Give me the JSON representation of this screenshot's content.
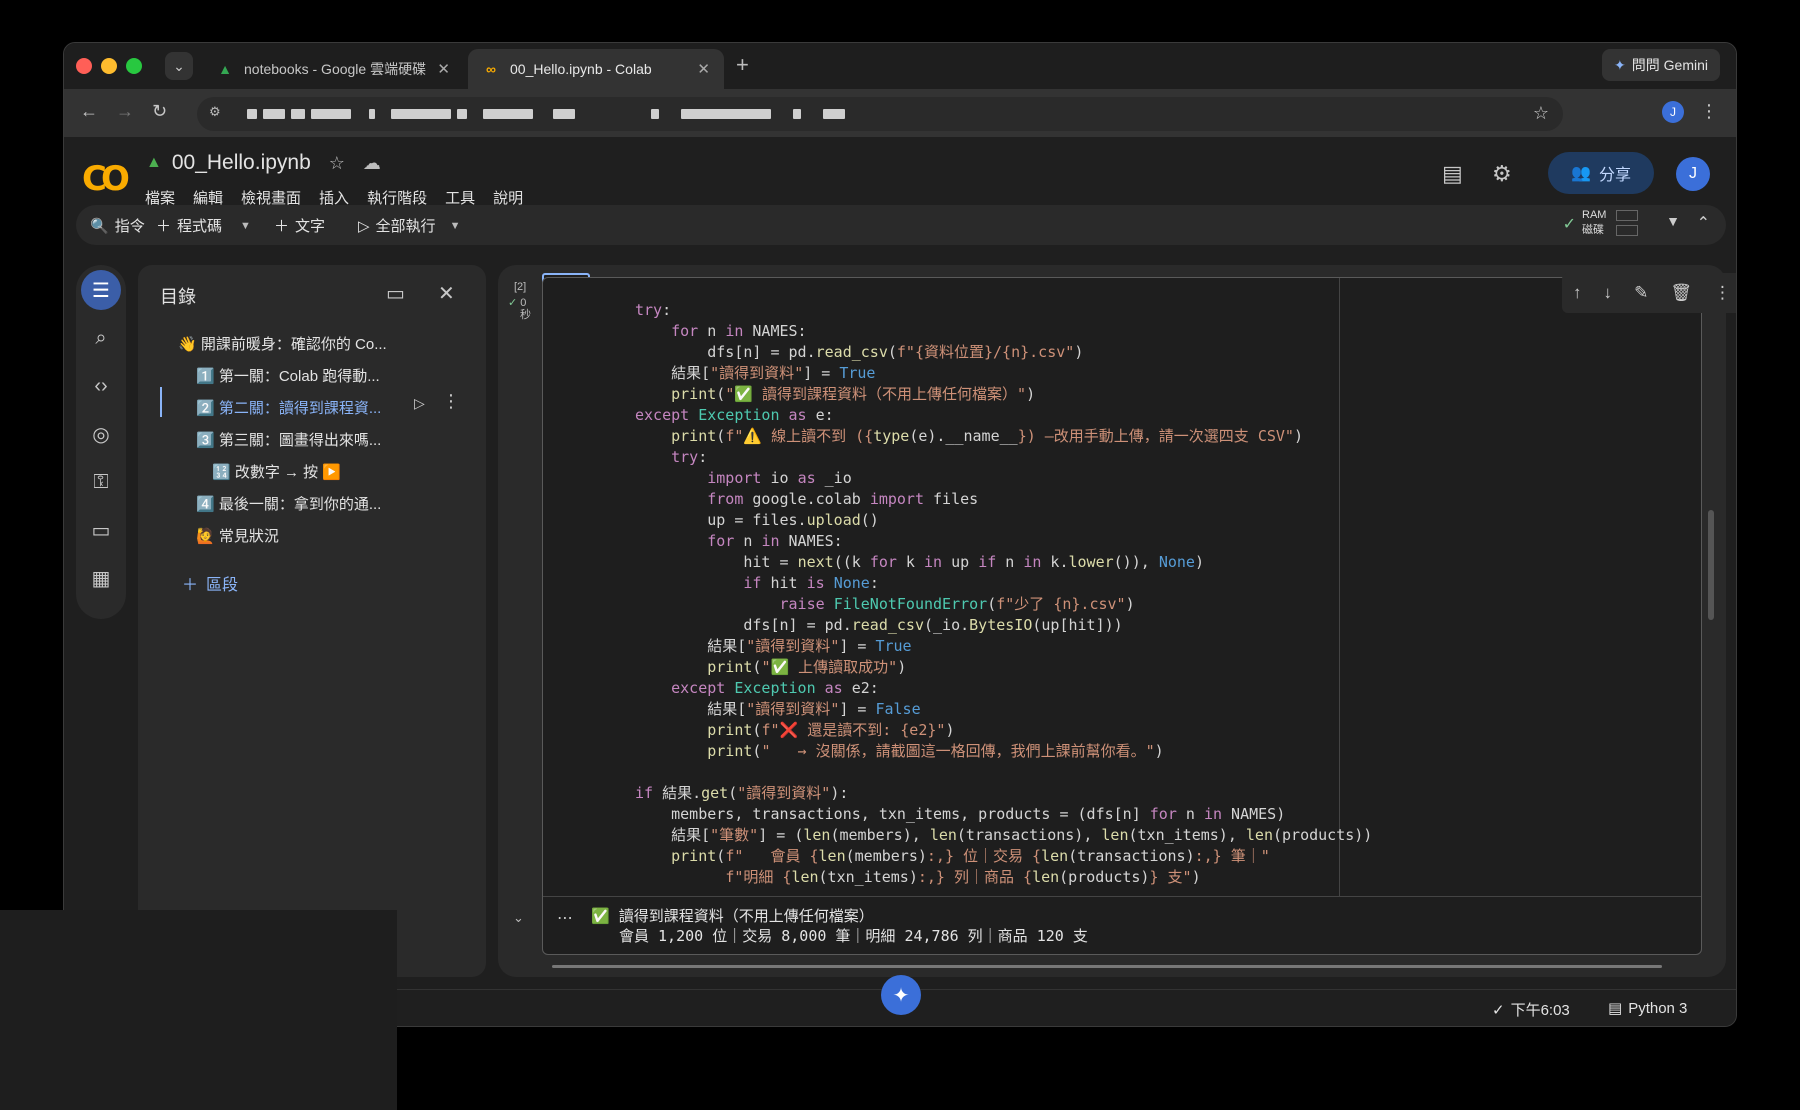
{
  "tabs": [
    {
      "label": "notebooks - Google 雲端硬碟",
      "icon": "drive-icon"
    },
    {
      "label": "00_Hello.ipynb - Colab",
      "icon": "colab-icon"
    }
  ],
  "gemini_button": "問問 Gemini",
  "notebook": {
    "title": "00_Hello.ipynb"
  },
  "menu": [
    "檔案",
    "編輯",
    "檢視畫面",
    "插入",
    "執行階段",
    "工具",
    "說明"
  ],
  "share_label": "分享",
  "user_initial": "J",
  "toolbar": {
    "commands": "指令",
    "code": "程式碼",
    "text": "文字",
    "run_all": "全部執行",
    "ram": "RAM",
    "disk": "磁碟"
  },
  "toc": {
    "title": "目錄",
    "items": [
      "👋 開課前暖身：確認你的 Co...",
      "1️⃣ 第一關：Colab 跑得動...",
      "2️⃣ 第二關：讀得到課程資...",
      "3️⃣ 第三關：圖畫得出來嗎...",
      "🔢 改數字 → 按 ▶️",
      "4️⃣ 最後一關：拿到你的通...",
      "🙋 常見狀況"
    ],
    "add_section": "區段"
  },
  "cell": {
    "exec_count": "[2]",
    "exec_time": "0",
    "exec_unit": "秒",
    "output_line1": "✅ 讀得到課程資料（不用上傳任何檔案）",
    "output_line2": "會員 1,200 位｜交易 8,000 筆｜明細 24,786 列｜商品 120 支"
  },
  "status": {
    "time": "下午6:03",
    "runtime": "Python 3"
  },
  "colors": {
    "accent": "#8ab4f8",
    "share_bg": "#1f3a5f",
    "colab_orange": "#f9ab00"
  }
}
